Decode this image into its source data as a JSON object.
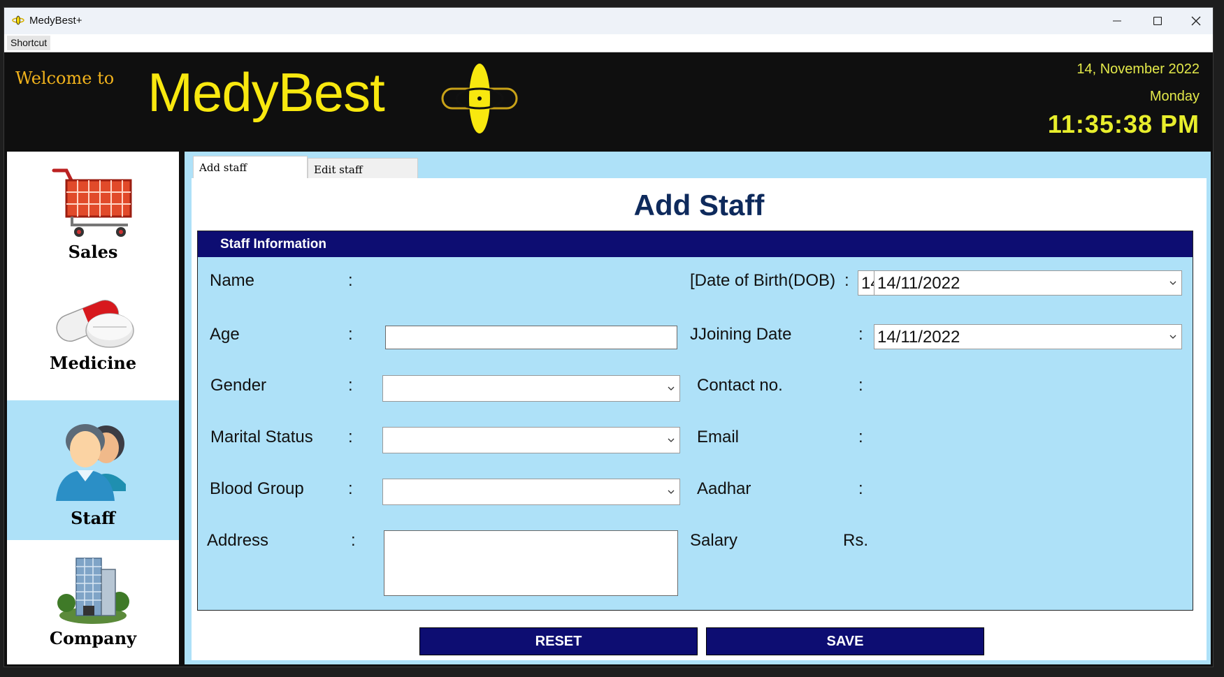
{
  "window": {
    "title": "MedyBest+",
    "minimize_icon": "minimize-icon",
    "maximize_icon": "maximize-icon",
    "close_icon": "close-icon"
  },
  "menubar": {
    "items": [
      "Shortcut"
    ]
  },
  "header": {
    "welcome": "Welcome to",
    "brand": "MedyBest",
    "date": "14, November 2022",
    "day": "Monday",
    "time": "11:35:38 PM",
    "colors": {
      "brand": "#f8e80f",
      "welcome": "#f2b31c",
      "clock": "#e8ee2c"
    }
  },
  "sidebar": {
    "items": [
      {
        "label": "Sales",
        "icon": "shopping-cart-icon"
      },
      {
        "label": "Medicine",
        "icon": "pills-icon"
      },
      {
        "label": "Staff",
        "icon": "staff-people-icon"
      },
      {
        "label": "Company",
        "icon": "building-icon"
      }
    ],
    "active": "Staff",
    "active_color": "#aee1f8"
  },
  "tabs": [
    "Add staff",
    "Edit staff"
  ],
  "form": {
    "title": "Add Staff",
    "section_title": "Staff Information",
    "colon": ":",
    "left": {
      "name": "Name",
      "age": "Age",
      "age_value": "",
      "gender": "Gender",
      "gender_value": "",
      "marital_status": "Marital Status",
      "marital_value": "",
      "blood_group": "Blood Group",
      "blood_value": "",
      "address": "Address",
      "address_value": ""
    },
    "right": {
      "dob": "[Date of Birth(DOB)",
      "dob_overlap": "14",
      "dob_value": "14/11/2022",
      "joining": "JJoining Date",
      "joining_value": "14/11/2022",
      "contact": "Contact no.",
      "email": "Email",
      "aadhar": "Aadhar",
      "salary": "Salary",
      "salary_unit": "Rs."
    },
    "buttons": {
      "reset": "RESET",
      "save": "SAVE"
    },
    "button_color": "#0d0d72"
  }
}
